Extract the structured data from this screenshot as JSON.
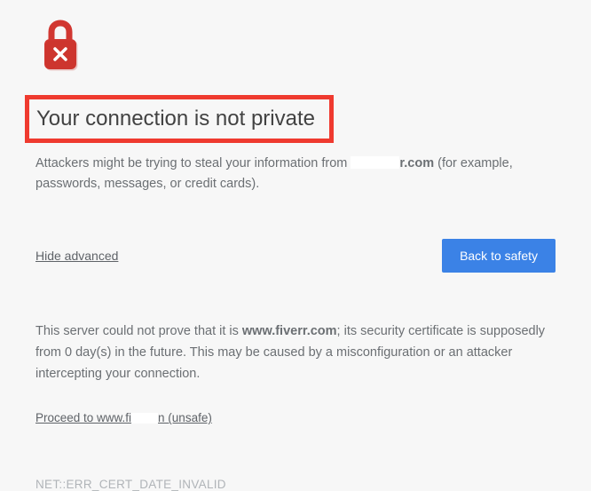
{
  "heading": "Your connection is not private",
  "subtext_prefix": "Attackers might be trying to steal your information from ",
  "subtext_domain_visible_suffix": "r.com",
  "subtext_suffix": " (for example, passwords, messages, or credit cards).",
  "actions": {
    "hide_advanced": "Hide advanced",
    "back_to_safety": "Back to safety"
  },
  "detail_prefix": "This server could not prove that it is ",
  "detail_domain": "www.fiverr.com",
  "detail_suffix": "; its security certificate is supposedly from 0 day(s) in the future. This may be caused by a misconfiguration or an attacker intercepting your connection.",
  "proceed_prefix": "Proceed to www.fi",
  "proceed_suffix": "n (unsafe)",
  "error_code": "NET::ERR_CERT_DATE_INVALID",
  "colors": {
    "highlight_border": "#ef3a2f",
    "button_bg": "#3b82e6",
    "lock_fill": "#d13731"
  }
}
